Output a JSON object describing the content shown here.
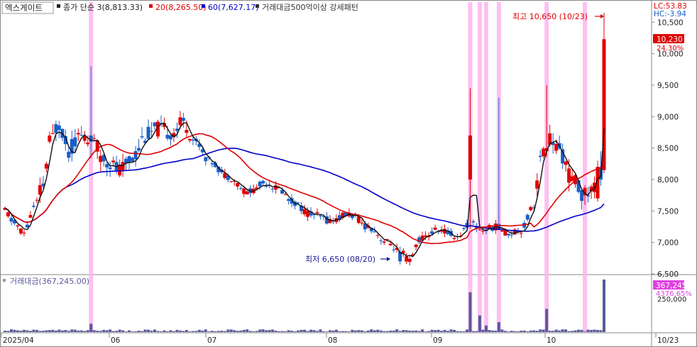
{
  "header": {
    "stock_name": "엑스게이트",
    "legend": [
      {
        "label": "종가 단순 3(8,813.33)",
        "color": "#222222"
      },
      {
        "label": "20(8,265.50)",
        "color": "#e00000"
      },
      {
        "label": "60(7,627.17)",
        "color": "#0000c8"
      },
      {
        "label": "거래대금500억이상 강세패턴",
        "color": "#333333"
      }
    ],
    "lc_label": "LC:53.83",
    "hc_label": "HC:-3.94"
  },
  "annotations": {
    "high_label": "최고 10,650 (10/23)",
    "low_label": "최저 6,650 (08/20)"
  },
  "price_tag": {
    "price": "10,230",
    "change": "24.30%"
  },
  "volume_pane": {
    "title": "거래대금(367,245.00)",
    "tag_value": "367,245",
    "tag_pct": "4376.65%"
  },
  "colors": {
    "up": "#e00000",
    "down": "#1a5fc8",
    "ma3": "#111111",
    "ma20": "#e00000",
    "ma60": "#0000c8",
    "highlight": "#ffb4f0",
    "volume_bar": "#5a5a9a"
  },
  "chart_data": {
    "type": "candlestick",
    "ylim": [
      6500,
      10650
    ],
    "y_ticks": [
      "6,500",
      "7,000",
      "7,500",
      "8,000",
      "8,500",
      "9,000",
      "9,500",
      "10,000",
      "10,500"
    ],
    "x_month_labels": [
      "2025/04",
      "06",
      "07",
      "08",
      "09",
      "10",
      "10/23"
    ],
    "volume_axis_label": "250,000",
    "highlight_candle_indices": [
      27,
      146,
      149,
      151,
      155,
      170,
      182
    ]
  }
}
